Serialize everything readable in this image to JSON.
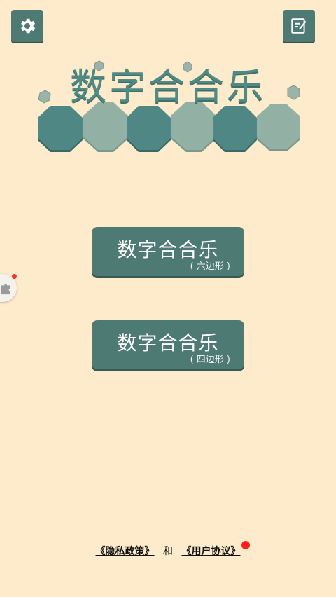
{
  "colors": {
    "background": "#fdebcb",
    "button": "#4e7a74",
    "hex_dark": "#4e8783",
    "hex_light": "#93b0a5",
    "logo_text": "#4f8a84",
    "badge": "#ff2a2a"
  },
  "icons": {
    "settings": "gear-icon",
    "notes": "edit-note-icon"
  },
  "logo": {
    "title": "数字合合乐"
  },
  "modes": [
    {
      "title": "数字合合乐",
      "subtitle": "( 六边形 )"
    },
    {
      "title": "数字合合乐",
      "subtitle": "( 四边形 )"
    }
  ],
  "footer": {
    "privacy": "《隐私政策》",
    "joiner": "和",
    "agreement": "《用户协议》"
  }
}
